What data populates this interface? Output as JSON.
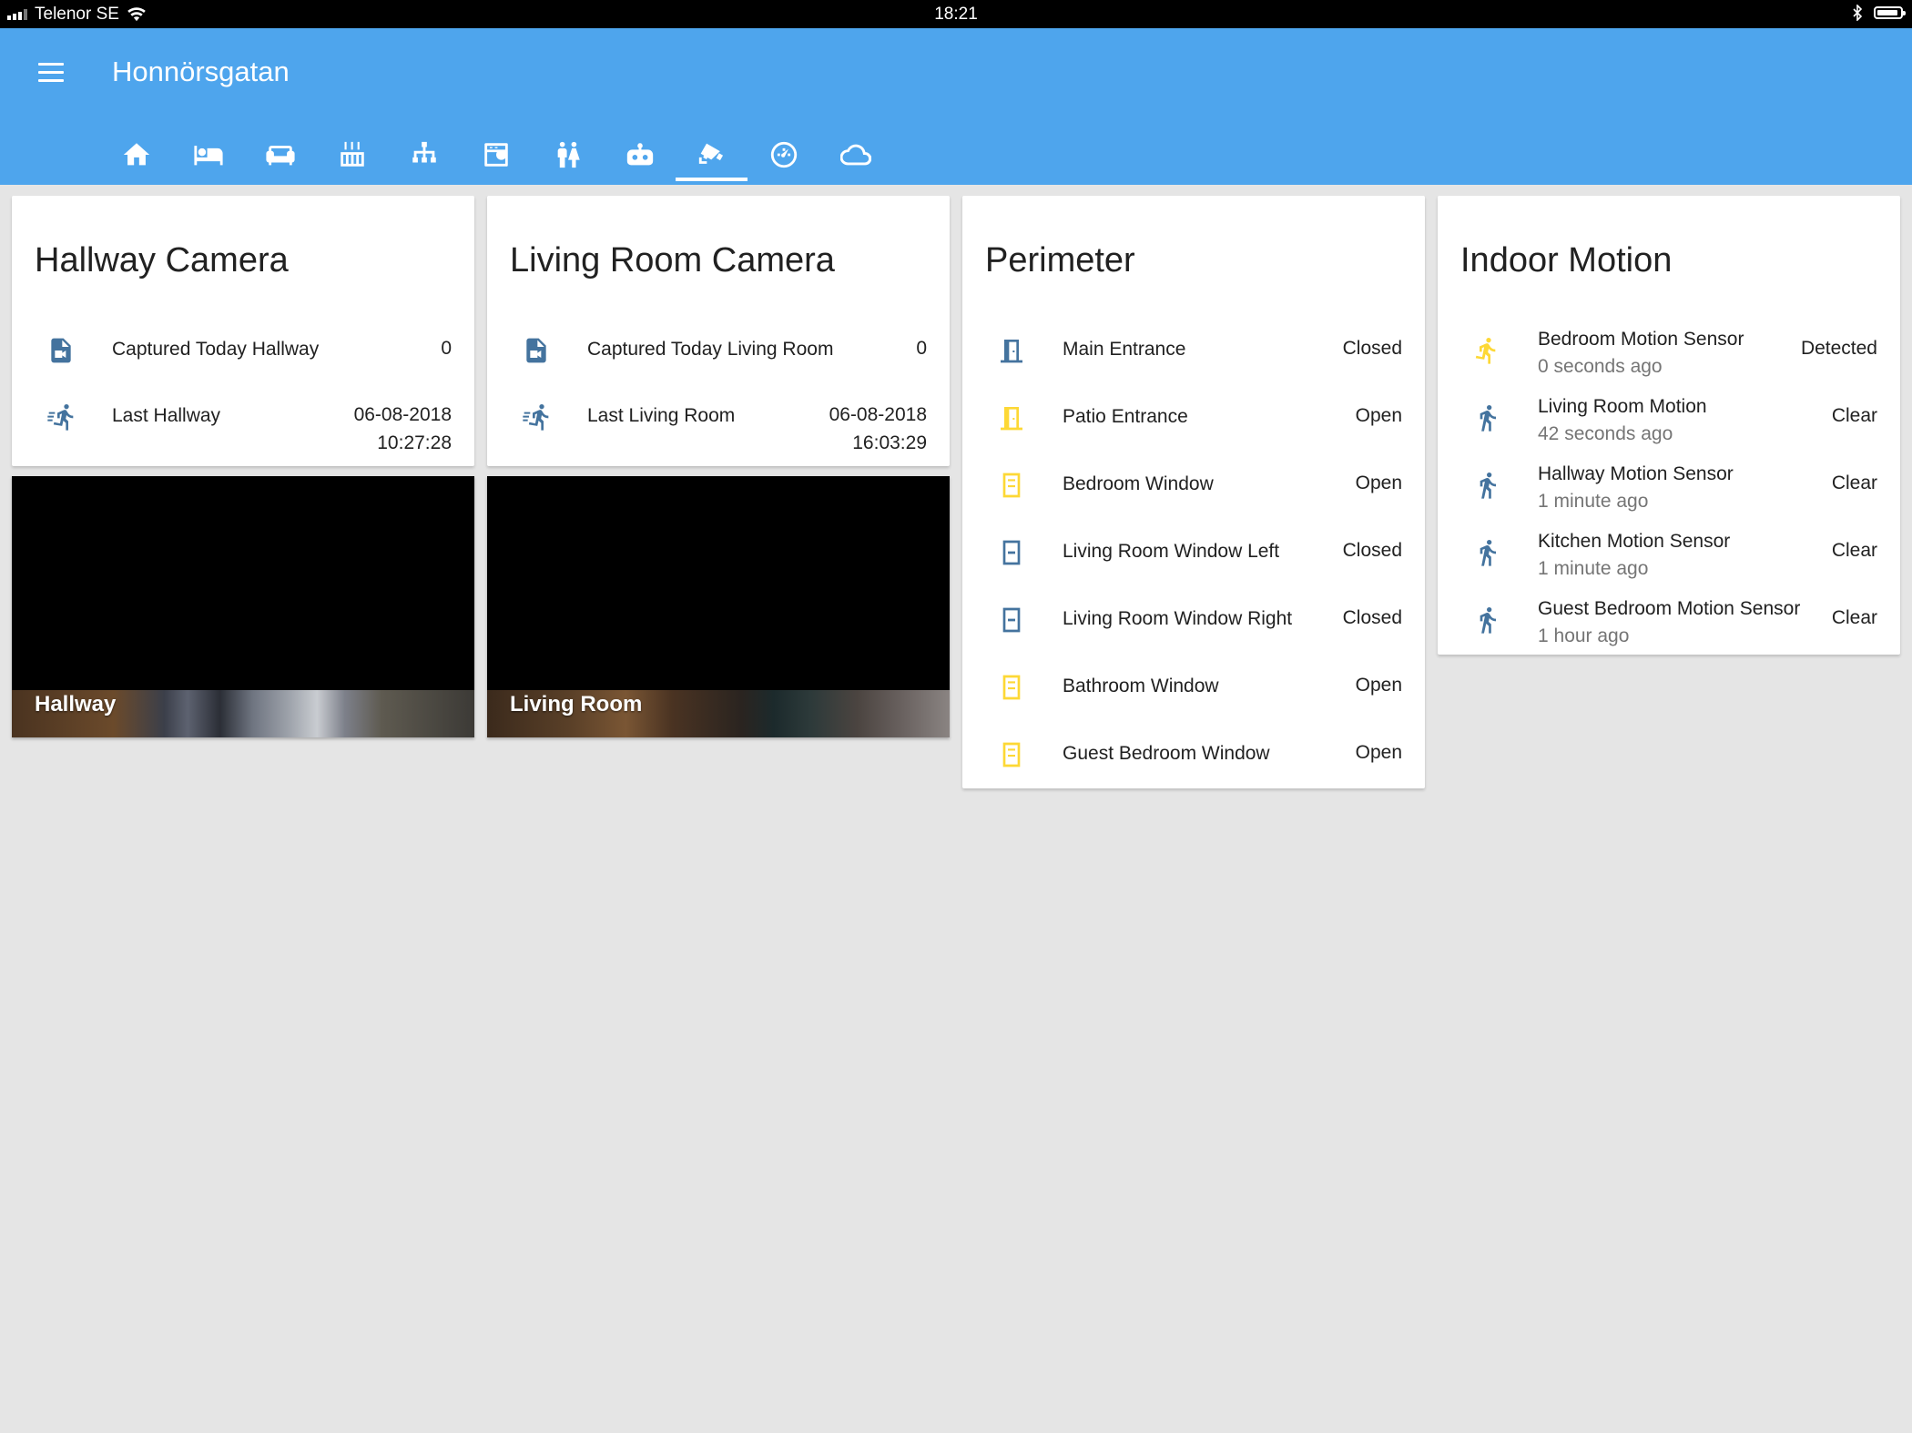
{
  "status_bar": {
    "carrier": "Telenor SE",
    "time": "18:21"
  },
  "header": {
    "title": "Honnörsgatan",
    "tabs": [
      {
        "icon": "home-icon"
      },
      {
        "icon": "bed-icon"
      },
      {
        "icon": "sofa-icon"
      },
      {
        "icon": "stove-icon"
      },
      {
        "icon": "hierarchy-icon"
      },
      {
        "icon": "washing-machine-icon"
      },
      {
        "icon": "human-male-female-icon"
      },
      {
        "icon": "robot-vacuum-icon"
      },
      {
        "icon": "cctv-icon",
        "active": true
      },
      {
        "icon": "speedometer-icon"
      },
      {
        "icon": "cloud-icon"
      }
    ]
  },
  "cards": {
    "hallway_camera": {
      "title": "Hallway Camera",
      "rows": [
        {
          "icon": "file-video-icon",
          "label": "Captured Today Hallway",
          "value": "0"
        },
        {
          "icon": "run-fast-icon",
          "label": "Last Hallway",
          "value_line1": "06-08-2018",
          "value_line2": "10:27:28"
        }
      ],
      "image_caption": "Hallway"
    },
    "living_room_camera": {
      "title": "Living Room Camera",
      "rows": [
        {
          "icon": "file-video-icon",
          "label": "Captured Today Living Room",
          "value": "0"
        },
        {
          "icon": "run-fast-icon",
          "label": "Last Living Room",
          "value_line1": "06-08-2018",
          "value_line2": "16:03:29"
        }
      ],
      "image_caption": "Living Room"
    },
    "perimeter": {
      "title": "Perimeter",
      "rows": [
        {
          "icon": "door-closed-icon",
          "label": "Main Entrance",
          "value": "Closed",
          "color": "#44739e"
        },
        {
          "icon": "door-open-icon",
          "label": "Patio Entrance",
          "value": "Open",
          "color": "#fdd835"
        },
        {
          "icon": "window-open-icon",
          "label": "Bedroom Window",
          "value": "Open",
          "color": "#fdd835"
        },
        {
          "icon": "window-closed-icon",
          "label": "Living Room Window Left",
          "value": "Closed",
          "color": "#44739e"
        },
        {
          "icon": "window-closed-icon",
          "label": "Living Room Window Right",
          "value": "Closed",
          "color": "#44739e"
        },
        {
          "icon": "window-open-icon",
          "label": "Bathroom Window",
          "value": "Open",
          "color": "#fdd835"
        },
        {
          "icon": "window-open-icon",
          "label": "Guest Bedroom Window",
          "value": "Open",
          "color": "#fdd835"
        }
      ]
    },
    "indoor_motion": {
      "title": "Indoor Motion",
      "rows": [
        {
          "icon": "run-icon",
          "label": "Bedroom Motion Sensor",
          "sub": "0 seconds ago",
          "value": "Detected",
          "color": "#fdd835"
        },
        {
          "icon": "walk-icon",
          "label": "Living Room Motion",
          "sub": "42 seconds ago",
          "value": "Clear",
          "color": "#44739e"
        },
        {
          "icon": "walk-icon",
          "label": "Hallway Motion Sensor",
          "sub": "1 minute ago",
          "value": "Clear",
          "color": "#44739e"
        },
        {
          "icon": "walk-icon",
          "label": "Kitchen Motion Sensor",
          "sub": "1 minute ago",
          "value": "Clear",
          "color": "#44739e"
        },
        {
          "icon": "walk-icon",
          "label": "Guest Bedroom Motion Sensor",
          "sub": "1 hour ago",
          "value": "Clear",
          "color": "#44739e"
        }
      ]
    }
  },
  "colors": {
    "header": "#4ea5ed",
    "background": "#e5e5e5",
    "icon_off": "#44739e",
    "icon_on": "#fdd835"
  }
}
